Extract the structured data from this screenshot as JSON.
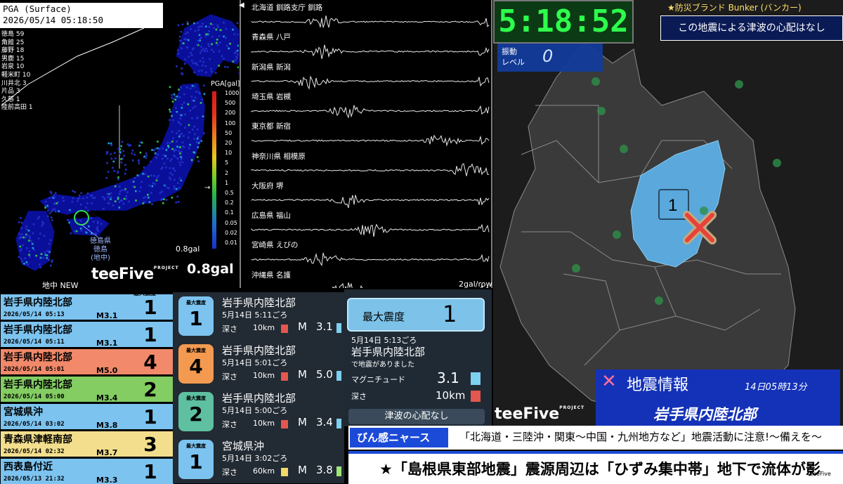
{
  "pga": {
    "title_line1": "PGA (Surface)",
    "title_line2": "2026/05/14 05:18:50",
    "list": [
      "徳島 59",
      "角館 25",
      "藤野 18",
      "男鹿 15",
      "岩泉 10",
      "軽米町 10",
      "川井北 3",
      "片品 3",
      "久慈 1",
      "陸前高田 1"
    ],
    "scale_title": "PGA[gal]",
    "scale_ticks": [
      "1000",
      "500",
      "200",
      "100",
      "50",
      "20",
      "10",
      "5",
      "2",
      "1",
      "0.5",
      "0.2",
      "0.1",
      "0.05",
      "0.02",
      "0.01"
    ],
    "marker_label": "徳島県\n徳島\n(地中)",
    "gal_small": "0.8gal",
    "gal_big": "0.8gal",
    "brand": "teeFive",
    "brand_sub": "PROJECT",
    "mode": "地中 NEW",
    "colors": {
      "station": "#2230c9",
      "land": "#0a0f9a"
    }
  },
  "waveform": {
    "arrow": "◀",
    "stations": [
      "北海道 釧路支庁 釧路",
      "青森県 八戸",
      "新潟県 新潟",
      "埼玉県 岩槻",
      "東京都 新宿",
      "神奈川県 相模原",
      "大阪府 堺",
      "広島県 福山",
      "宮崎県 えびの",
      "沖縄県 名護"
    ],
    "scale": "2gal/row"
  },
  "clock": "5:18:52",
  "sponsor": "★防災ブランド Bunker (バンカー)",
  "tsunami_top": "この地震による津波の心配はなし",
  "shindo_live": {
    "label1": "振動",
    "label2": "レベル",
    "value": "0"
  },
  "map": {
    "epicenter_intensity": "1",
    "colors": {
      "area": "#5aa8dc",
      "land": "#3a3a3a",
      "sea": "#1c1c1c"
    }
  },
  "info": {
    "title": "地震情報",
    "time": "14日05時13分",
    "area": "岩手県内陸北部",
    "brand": "teeFive",
    "brand_sub": "PROJECT"
  },
  "history": [
    {
      "area": "岩手県内陸北部",
      "datetime": "2026/05/14 05:13",
      "mag": "M3.1",
      "shindo": "1",
      "color": "#7cc3f0"
    },
    {
      "area": "岩手県内陸北部",
      "datetime": "2026/05/14 05:11",
      "mag": "M3.1",
      "shindo": "1",
      "color": "#7cc3f0"
    },
    {
      "area": "岩手県内陸北部",
      "datetime": "2026/05/14 05:01",
      "mag": "M5.0",
      "shindo": "4",
      "color": "#f1896a"
    },
    {
      "area": "岩手県内陸北部",
      "datetime": "2026/05/14 05:00",
      "mag": "M3.4",
      "shindo": "2",
      "color": "#83cd62"
    },
    {
      "area": "宮城県沖",
      "datetime": "2026/05/14 03:02",
      "mag": "M3.8",
      "shindo": "1",
      "color": "#7cc3f0"
    },
    {
      "area": "青森県津軽南部",
      "datetime": "2026/05/14 02:32",
      "mag": "M3.7",
      "shindo": "3",
      "color": "#f2de8c"
    },
    {
      "area": "西表島付近",
      "datetime": "2026/05/13 21:32",
      "mag": "M3.3",
      "shindo": "1",
      "color": "#7cc3f0"
    }
  ],
  "history_header": "最大震度",
  "cards": [
    {
      "badge_label": "最大震度",
      "shindo": "1",
      "area": "岩手県内陸北部",
      "time": "5月14日 5:11ごろ",
      "depth_label": "深さ",
      "depth": "10km",
      "depth_color": "#e3574e",
      "m": "M",
      "mag": "3.1",
      "mag_color": "#7dd0ee",
      "badge_color": "#7cc3f0"
    },
    {
      "badge_label": "最大震度",
      "shindo": "4",
      "area": "岩手県内陸北部",
      "time": "5月14日 5:01ごろ",
      "depth_label": "深さ",
      "depth": "10km",
      "depth_color": "#e3574e",
      "m": "M",
      "mag": "5.0",
      "mag_color": "#7dd0ee",
      "badge_color": "#f39a50"
    },
    {
      "badge_label": "最大震度",
      "shindo": "2",
      "area": "岩手県内陸北部",
      "time": "5月14日 5:00ごろ",
      "depth_label": "深さ",
      "depth": "10km",
      "depth_color": "#e3574e",
      "m": "M",
      "mag": "3.4",
      "mag_color": "#7dd0ee",
      "badge_color": "#5ec0a0"
    },
    {
      "badge_label": "最大震度",
      "shindo": "1",
      "area": "宮城県沖",
      "time": "5月14日 3:02ごろ",
      "depth_label": "深さ",
      "depth": "60km",
      "depth_color": "#f0d96a",
      "m": "M",
      "mag": "3.8",
      "mag_color": "#9ee57a",
      "badge_color": "#7cc3f0"
    }
  ],
  "detail": {
    "max_label": "最大震度",
    "max_value": "1",
    "time": "5月14日 5:13ごろ",
    "area": "岩手県内陸北部",
    "note": "で地震がありました",
    "mag_label": "マグニチュード",
    "mag_value": "3.1",
    "depth_label": "深さ",
    "depth_value": "10km",
    "tsunami": "津波の心配なし"
  },
  "ticker": {
    "tag": "びん感ニャース",
    "line1": "「北海道・三陸沖・関東～中国・九州地方など」地震活動に注意!～備えを～",
    "line2": "★「島根県東部地震」震源周辺は「ひずみ集中帯」地下で流体が影",
    "logo": "teeFive"
  }
}
